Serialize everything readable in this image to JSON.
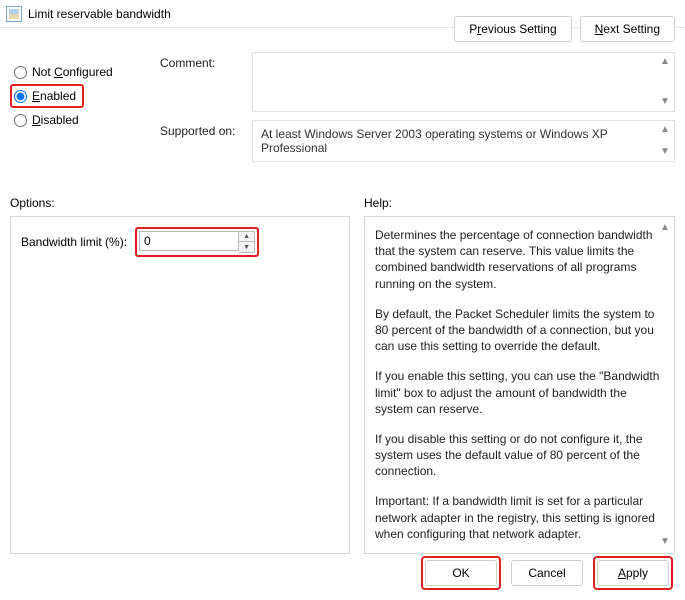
{
  "title": "Limit reservable bandwidth",
  "nav": {
    "prev_pre": "P",
    "prev_und": "r",
    "prev_post": "evious Setting",
    "next_pre": "",
    "next_und": "N",
    "next_post": "ext Setting"
  },
  "radios": {
    "not_configured_pre": "Not ",
    "not_configured_und": "C",
    "not_configured_post": "onfigured",
    "enabled_pre": "",
    "enabled_und": "E",
    "enabled_post": "nabled",
    "disabled_pre": "",
    "disabled_und": "D",
    "disabled_post": "isabled"
  },
  "fields": {
    "comment_label": "Comment:",
    "comment_value": "",
    "supported_label": "Supported on:",
    "supported_value": "At least Windows Server 2003 operating systems or Windows XP Professional"
  },
  "options": {
    "header": "Options:",
    "bandwidth_label": "Bandwidth limit (%):",
    "bandwidth_value": "0"
  },
  "help": {
    "header": "Help:",
    "p1": "Determines the percentage of connection bandwidth that the system can reserve. This value limits the combined bandwidth reservations of all programs running on the system.",
    "p2": "By default, the Packet Scheduler limits the system to 80 percent of the bandwidth of a connection, but you can use this setting to override the default.",
    "p3": "If you enable this setting, you can use the \"Bandwidth limit\" box to adjust the amount of bandwidth the system can reserve.",
    "p4": "If you disable this setting or do not configure it, the system uses the default value of 80 percent of the connection.",
    "p5": "Important: If a bandwidth limit is set for a particular network adapter in the registry, this setting is ignored when configuring that network adapter."
  },
  "buttons": {
    "ok": "OK",
    "cancel": "Cancel",
    "apply_pre": "",
    "apply_und": "A",
    "apply_post": "pply"
  },
  "glyphs": {
    "up": "▲",
    "down": "▼"
  }
}
